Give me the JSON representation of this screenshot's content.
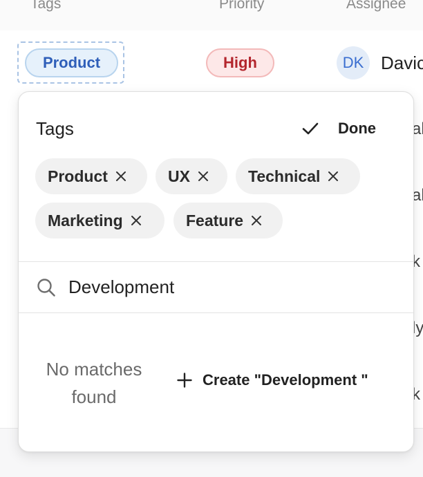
{
  "table": {
    "headers": [
      "Tags",
      "Priority",
      "Assignee"
    ],
    "row1": {
      "tag": "Product",
      "priority": "High",
      "avatar_initials": "DK",
      "assignee": "Davic"
    },
    "peek": [
      "al",
      "al",
      "k",
      "ly",
      "k"
    ]
  },
  "popover": {
    "title": "Tags",
    "done_label": "Done",
    "selected_tags": [
      {
        "label": "Product"
      },
      {
        "label": "UX"
      },
      {
        "label": "Technical"
      },
      {
        "label": "Marketing"
      },
      {
        "label": "Feature"
      }
    ],
    "search_value": "Development",
    "empty_message": "No matches found",
    "create_label": "Create \"Development \""
  },
  "icons": [
    "check-icon",
    "close-icon",
    "search-icon",
    "plus-icon"
  ],
  "colors": {
    "tag_blue_text": "#2f5fb9",
    "tag_blue_bg": "#e6f1fb",
    "priority_high_text": "#b3262d",
    "priority_high_bg": "#fde8e8",
    "chip_bg": "#f1f1f1"
  }
}
